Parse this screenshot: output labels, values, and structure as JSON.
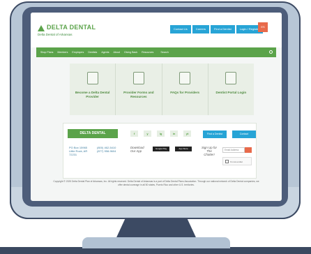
{
  "header": {
    "logo_text": "DELTA DENTAL",
    "subtitle": "Delta Dental of Arkansas",
    "top_buttons": [
      "Contact Us",
      "Careers",
      "Find a Dentist",
      "Login / Register"
    ],
    "language": "ES"
  },
  "main_nav": {
    "items": [
      "Shop Plans",
      "Members",
      "Employers",
      "Dentists",
      "Agents",
      "About",
      "Giving Back",
      "Resources"
    ],
    "search_label": "Search"
  },
  "tiles": [
    {
      "label": "Become a Delta Dental Provider"
    },
    {
      "label": "Provider Forms and Resources"
    },
    {
      "label": "FAQs for Providers"
    },
    {
      "label": "Dentist Portal Login"
    }
  ],
  "footer": {
    "logo_text": "DELTA DENTAL",
    "address": "PO Box 15965\nLittle Rock, AR\n72231",
    "phone": "(800) 462-5410\n(877) 958-9604",
    "social": [
      "f",
      "y",
      "ig",
      "in",
      "yt"
    ],
    "find_dentist": "Find a Dentist",
    "contact": "Contact",
    "download_label": "Download\nOur App",
    "google_play": "Google Play",
    "app_store": "App Store",
    "signup_label": "Sign Up for\nThe\nChatter!",
    "email_placeholder": "Email Address",
    "captcha_label": "I'm not a robot"
  },
  "copyright": "Copyright © 2025 Delta Dental Plan of Arkansas, Inc. All rights reserved.\nDelta Dental of Arkansas is a part of Delta Dental Plans Association. Through our national network of Delta Dental companies, we offer dental coverage in all 50 states, Puerto Rico and other U.S. territories.",
  "colors": {
    "brand_green": "#5ba34a",
    "accent_blue": "#27a4d6",
    "accent_orange": "#e86a4b",
    "bezel": "#4d5d7a"
  }
}
